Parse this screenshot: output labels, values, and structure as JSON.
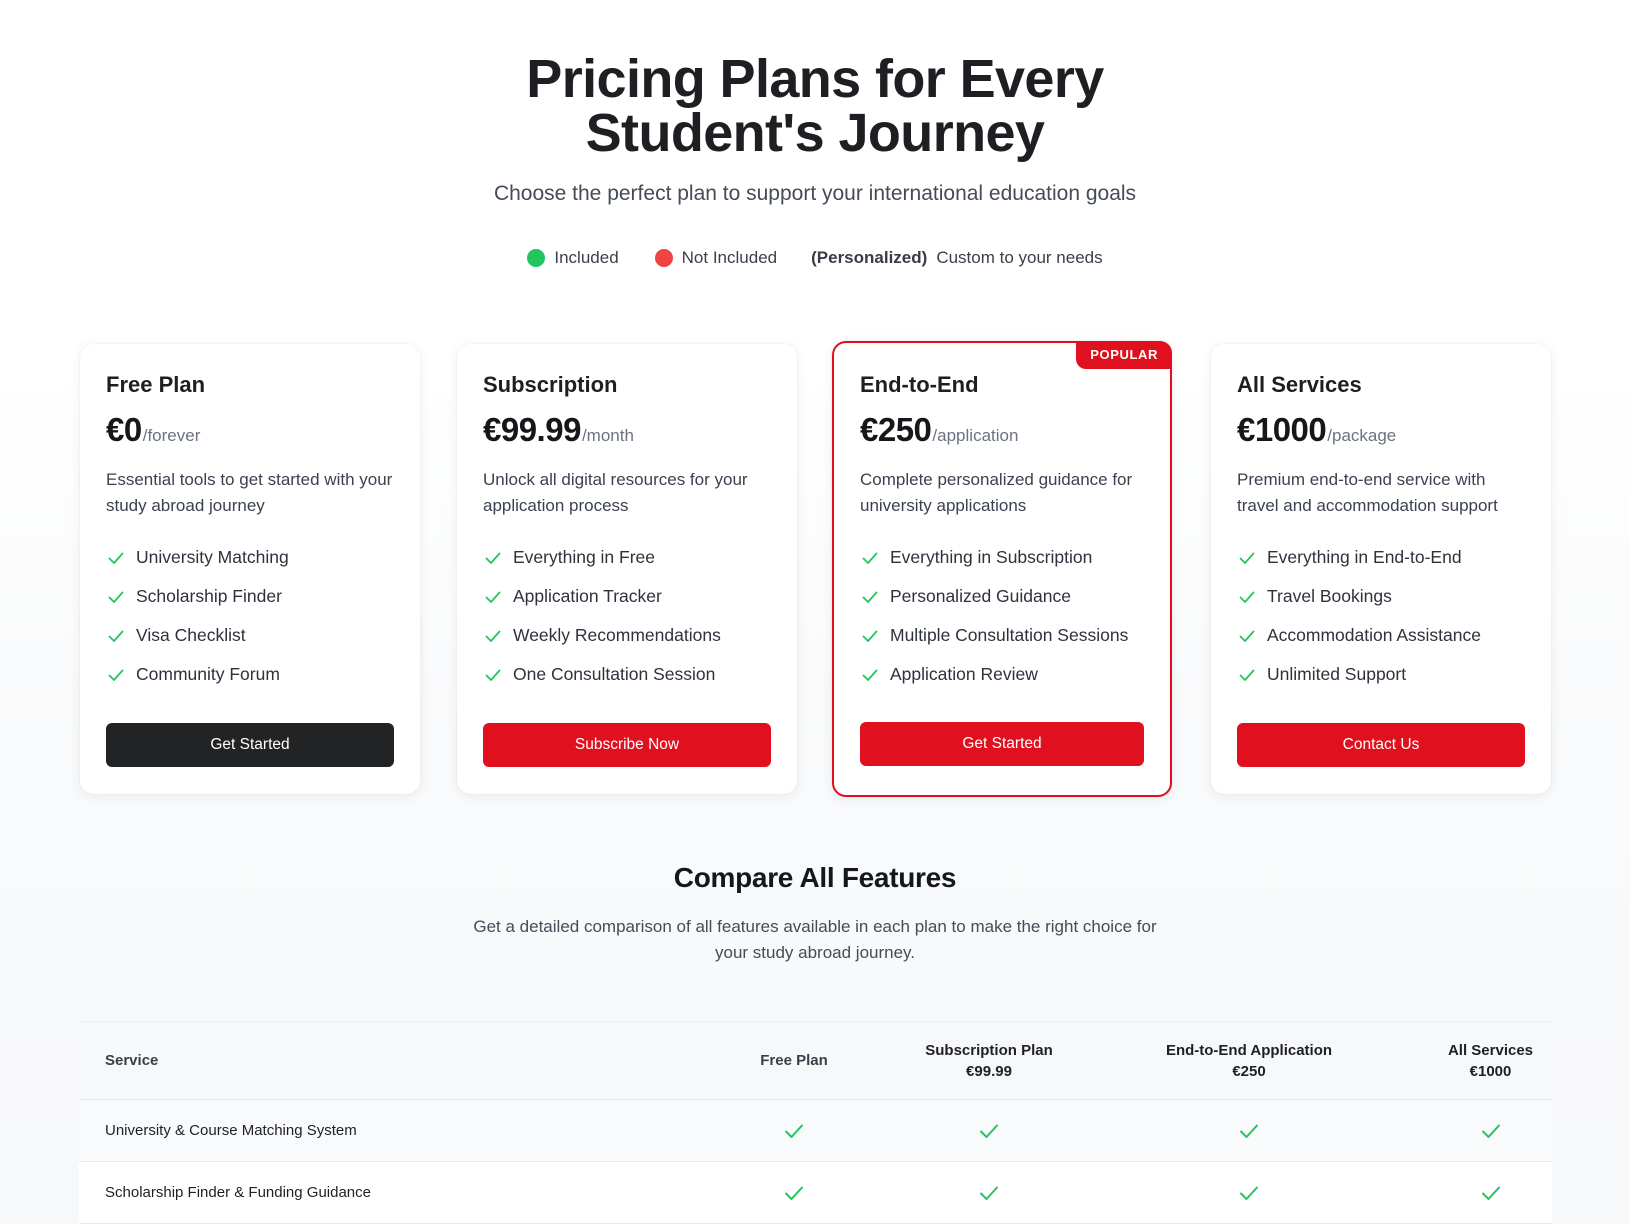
{
  "hero": {
    "title": "Pricing Plans for Every Student's Journey",
    "subtitle": "Choose the perfect plan to support your international education goals"
  },
  "legend": {
    "included": "Included",
    "not_included": "Not Included",
    "personalized_label": "(Personalized)",
    "personalized_desc": "Custom to your needs",
    "colors": {
      "included": "#22c55e",
      "not_included": "#ef4444"
    }
  },
  "plans": [
    {
      "name": "Free Plan",
      "price": "€0",
      "period": "/forever",
      "description": "Essential tools to get started with your study abroad journey",
      "features": [
        "University Matching",
        "Scholarship Finder",
        "Visa Checklist",
        "Community Forum"
      ],
      "button": "Get Started"
    },
    {
      "name": "Subscription",
      "price": "€99.99",
      "period": "/month",
      "description": "Unlock all digital resources for your application process",
      "features": [
        "Everything in Free",
        "Application Tracker",
        "Weekly Recommendations",
        "One Consultation Session"
      ],
      "button": "Subscribe Now"
    },
    {
      "name": "End-to-End",
      "badge": "POPULAR",
      "price": "€250",
      "period": "/application",
      "description": "Complete personalized guidance for university applications",
      "features": [
        "Everything in Subscription",
        "Personalized Guidance",
        "Multiple Consultation Sessions",
        "Application Review"
      ],
      "button": "Get Started"
    },
    {
      "name": "All Services",
      "price": "€1000",
      "period": "/package",
      "description": "Premium end-to-end service with travel and accommodation support",
      "features": [
        "Everything in End-to-End",
        "Travel Bookings",
        "Accommodation Assistance",
        "Unlimited Support"
      ],
      "button": "Contact Us"
    }
  ],
  "compare": {
    "title": "Compare All Features",
    "description": "Get a detailed comparison of all features available in each plan to make the right choice for your study abroad journey.",
    "headers": {
      "service": "Service",
      "free": "Free Plan",
      "subscription": "Subscription Plan",
      "subscription_price": "€99.99",
      "end_to_end": "End-to-End Application",
      "end_to_end_price": "€250",
      "all": "All Services",
      "all_price": "€1000"
    },
    "rows": [
      {
        "service": "University & Course Matching System",
        "free": "included",
        "subscription": "included",
        "end_to_end": "included",
        "all": "included"
      },
      {
        "service": "Scholarship Finder & Funding Guidance",
        "free": "included",
        "subscription": "included",
        "end_to_end": "included",
        "all": "included"
      }
    ]
  },
  "colors": {
    "accent": "#e0101e",
    "dark_button": "#222325",
    "check": "#22c55e"
  }
}
